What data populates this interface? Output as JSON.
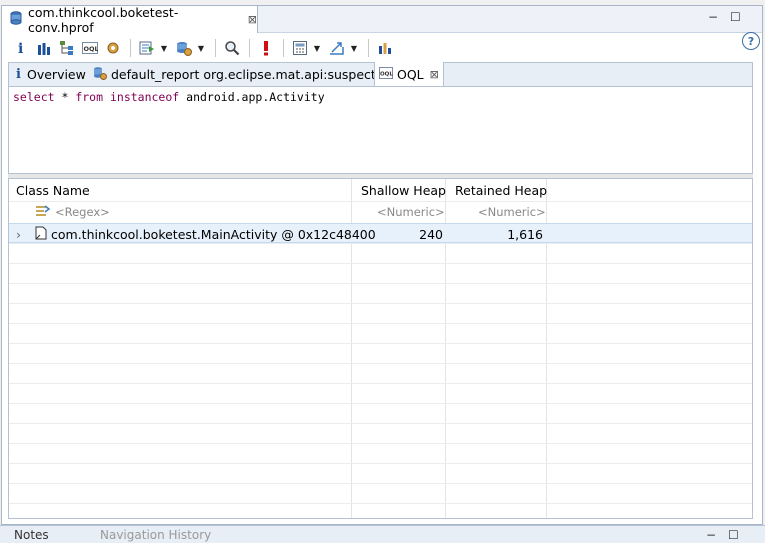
{
  "editor": {
    "tab_title": "com.thinkcool.boketest-conv.hprof",
    "tab_close": "⊠"
  },
  "window_controls": {
    "minimize": "−",
    "maximize": "☐"
  },
  "toolbar": {
    "help": "?"
  },
  "subtabs": [
    {
      "label": "Overview"
    },
    {
      "label": "default_report  org.eclipse.mat.api:suspects"
    },
    {
      "label": "OQL",
      "close": "⊠"
    }
  ],
  "query": {
    "kw1": "select",
    "mid": " * ",
    "kw2": "from",
    "kw3": "instanceof",
    "class": "android.app.Activity"
  },
  "table": {
    "columns": [
      "Class Name",
      "Shallow Heap",
      "Retained Heap"
    ],
    "filters": [
      "<Regex>",
      "<Numeric>",
      "<Numeric>"
    ],
    "rows": [
      {
        "class_name": "com.thinkcool.boketest.MainActivity @ 0x12c48400",
        "shallow": "240",
        "retained": "1,616",
        "expander": "›"
      }
    ]
  },
  "bottom_tabs": [
    {
      "label": "Notes"
    },
    {
      "label": "Navigation History"
    }
  ],
  "colors": {
    "keyword": "#7f0055",
    "selection": "#e7f1fb",
    "accent": "#3a6ea5"
  }
}
